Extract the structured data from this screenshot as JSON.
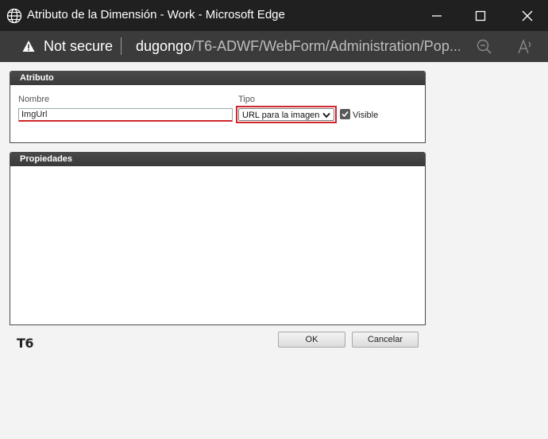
{
  "window": {
    "title": "Atributo de la Dimensión - Work - Microsoft Edge",
    "icon": "globe-icon",
    "controls": [
      "minimize-icon",
      "maximize-icon",
      "close-icon"
    ]
  },
  "address_bar": {
    "security_label": "Not secure",
    "url_host": "dugongo",
    "url_path": "/T6-ADWF/WebForm/Administration/Pop..."
  },
  "attribute_panel": {
    "header": "Atributo",
    "name_label": "Nombre",
    "name_value": "ImgUrl",
    "type_label": "Tipo",
    "type_selected": "URL para la imagen",
    "visible_label": "Visible",
    "visible_checked": true
  },
  "properties_panel": {
    "header": "Propiedades"
  },
  "footer": {
    "logo_text": "T6",
    "ok_label": "OK",
    "cancel_label": "Cancelar"
  },
  "colors": {
    "titlebar": "#202020",
    "addressbar": "#3b3b3b",
    "panel_header": "#3f3f3f",
    "highlight_red": "#d0252b"
  }
}
